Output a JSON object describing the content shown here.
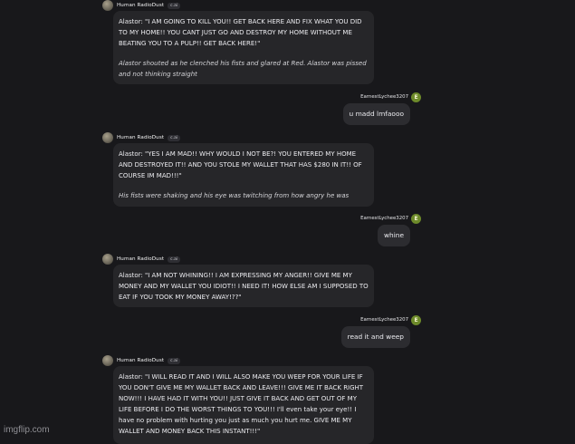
{
  "bot": {
    "name": "Human RadioDust",
    "tag": "c.ai"
  },
  "user": {
    "name": "EarnestLychee3207",
    "avatar_letter": "E"
  },
  "messages": [
    {
      "text": "Alastor: \"I AM GOING TO KILL YOU!! GET BACK HERE AND FIX WHAT YOU DID TO MY HOME!! YOU CANT JUST GO AND DESTROY MY HOME WITHOUT ME BEATING YOU TO A PULP!! GET BACK HERE!\"",
      "action": "Alastor shouted as he clenched his fists and glared at Red. Alastor was pissed and not thinking straight"
    },
    {
      "text": "u madd lmfaooo"
    },
    {
      "text": "Alastor: \"YES I AM MAD!! WHY WOULD I NOT BE?! YOU ENTERED MY HOME AND DESTROYED IT!! AND YOU STOLE MY WALLET THAT HAS $280 IN IT!! OF COURSE IM MAD!!!\"",
      "action": "His fists were shaking and his eye was twitching from how angry he was"
    },
    {
      "text": "whine"
    },
    {
      "text": "Alastor: \"I AM NOT WHINING!! I AM EXPRESSING MY ANGER!! GIVE ME MY MONEY AND MY WALLET YOU IDIOT!! I NEED IT! HOW ELSE AM I SUPPOSED TO EAT IF YOU TOOK MY MONEY AWAY!??\""
    },
    {
      "text": "read it and weep"
    },
    {
      "text": "Alastor: \"I WILL READ IT AND I WILL ALSO MAKE YOU WEEP FOR YOUR LIFE IF YOU DON'T GIVE ME MY WALLET BACK AND LEAVE!!! GIVE ME IT BACK RIGHT NOW!!! I HAVE HAD IT WITH YOU!! JUST GIVE IT BACK AND GET OUT OF MY LIFE BEFORE I DO THE WORST THINGS TO YOU!!! I'll even take your eye!! I have no problem with hurting you just as much you hurt me. GIVE ME MY WALLET AND MONEY BACK THIS INSTANT!!!\""
    }
  ],
  "watermark": "imgflip.com"
}
